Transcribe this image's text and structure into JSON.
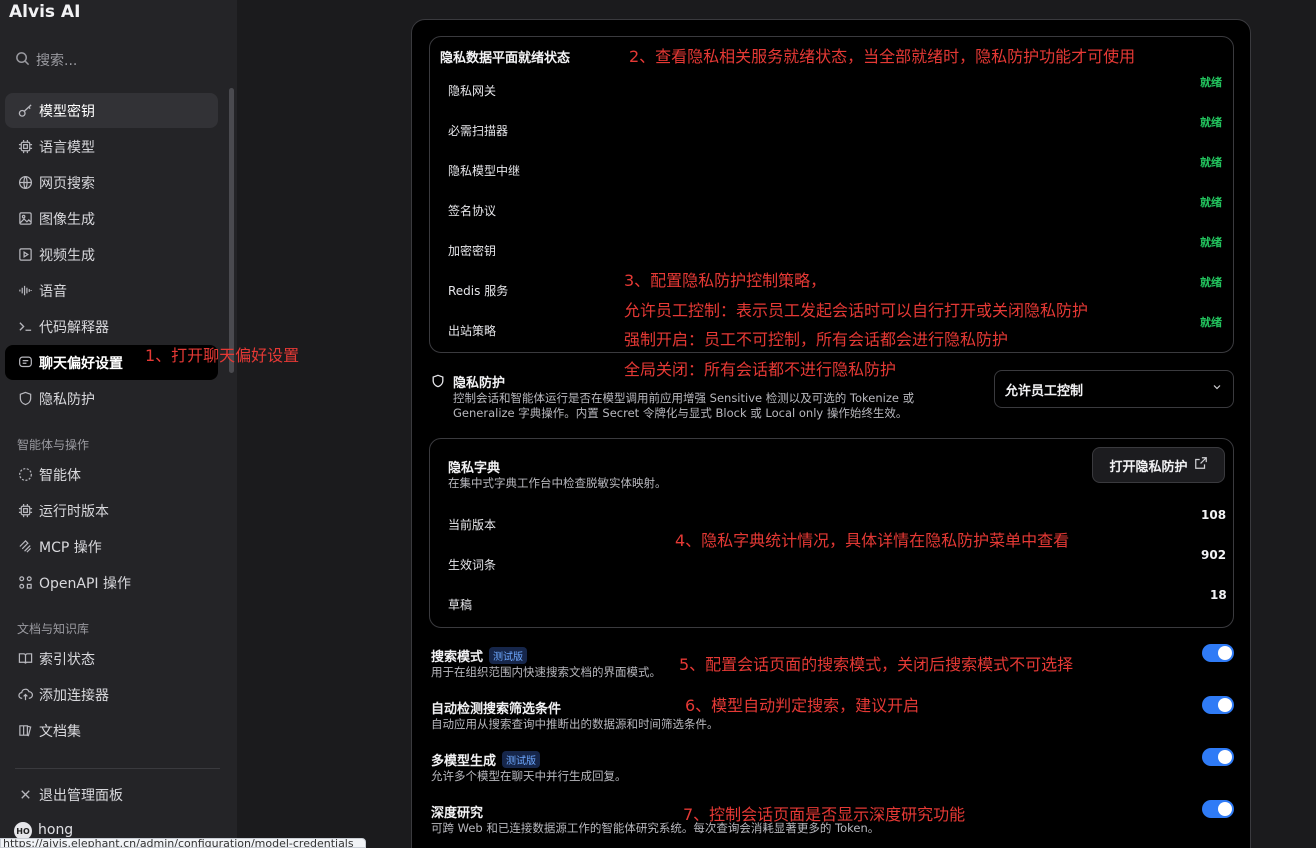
{
  "sidebar": {
    "app_title": "Alvis AI",
    "search_placeholder": "搜索...",
    "items": [
      {
        "label": "模型密钥",
        "icon": "key-icon"
      },
      {
        "label": "语言模型",
        "icon": "cpu-icon"
      },
      {
        "label": "网页搜索",
        "icon": "globe-icon"
      },
      {
        "label": "图像生成",
        "icon": "image-icon"
      },
      {
        "label": "视频生成",
        "icon": "video-icon"
      },
      {
        "label": "语音",
        "icon": "audio-wave-icon"
      },
      {
        "label": "代码解释器",
        "icon": "terminal-icon"
      },
      {
        "label": "聊天偏好设置",
        "icon": "chat-icon"
      },
      {
        "label": "隐私防护",
        "icon": "shield-icon"
      }
    ],
    "section_agents": "智能体与操作",
    "agent_items": [
      {
        "label": "智能体",
        "icon": "agent-icon"
      },
      {
        "label": "运行时版本",
        "icon": "cpu-icon"
      },
      {
        "label": "MCP 操作",
        "icon": "mcp-icon"
      },
      {
        "label": "OpenAPI 操作",
        "icon": "openapi-icon"
      }
    ],
    "section_docs": "文档与知识库",
    "doc_items": [
      {
        "label": "索引状态",
        "icon": "book-icon"
      },
      {
        "label": "添加连接器",
        "icon": "upload-cloud-icon"
      },
      {
        "label": "文档集",
        "icon": "files-icon"
      }
    ],
    "exit_label": "退出管理面板",
    "user_initials": "HO",
    "username": "hong",
    "status_url": "https://aivis.elephant.cn/admin/configuration/model-credentials"
  },
  "privacy_status": {
    "title": "隐私数据平面就绪状态",
    "rows": [
      {
        "label": "隐私网关",
        "status": "就绪"
      },
      {
        "label": "必需扫描器",
        "status": "就绪"
      },
      {
        "label": "隐私模型中继",
        "status": "就绪"
      },
      {
        "label": "签名协议",
        "status": "就绪"
      },
      {
        "label": "加密密钥",
        "status": "就绪"
      },
      {
        "label": "Redis 服务",
        "status": "就绪"
      },
      {
        "label": "出站策略",
        "status": "就绪"
      }
    ]
  },
  "privacy_protection": {
    "title": "隐私防护",
    "desc_line1": "控制会话和智能体运行是否在模型调用前应用增强 Sensitive 检测以及可选的 Tokenize 或",
    "desc_line2": "Generalize 字典操作。内置 Secret 令牌化与显式 Block 或 Local only 操作始终生效。",
    "selected_option": "允许员工控制"
  },
  "privacy_dictionary": {
    "title": "隐私字典",
    "desc": "在集中式字典工作台中检查脱敏实体映射。",
    "open_button": "打开隐私防护",
    "stats": [
      {
        "label": "当前版本",
        "value": "108"
      },
      {
        "label": "生效词条",
        "value": "902"
      },
      {
        "label": "草稿",
        "value": "18"
      }
    ]
  },
  "settings": [
    {
      "title": "搜索模式",
      "beta": "测试版",
      "desc": "用于在组织范围内快速搜索文档的界面模式。",
      "enabled": true
    },
    {
      "title": "自动检测搜索筛选条件",
      "beta": "",
      "desc": "自动应用从搜索查询中推断出的数据源和时间筛选条件。",
      "enabled": true
    },
    {
      "title": "多模型生成",
      "beta": "测试版",
      "desc": "允许多个模型在聊天中并行生成回复。",
      "enabled": true
    },
    {
      "title": "深度研究",
      "beta": "",
      "desc": "可跨 Web 和已连接数据源工作的智能体研究系统。每次查询会消耗显著更多的 Token。",
      "enabled": true
    }
  ],
  "annotations": {
    "a1": "1、打开聊天偏好设置",
    "a2": "2、查看隐私相关服务就绪状态，当全部就绪时，隐私防护功能才可使用",
    "a3_1": "3、配置隐私防护控制策略，",
    "a3_2": "允许员工控制：表示员工发起会话时可以自行打开或关闭隐私防护",
    "a3_3": "强制开启：员工不可控制，所有会话都会进行隐私防护",
    "a3_4": "全局关闭：所有会话都不进行隐私防护",
    "a4": "4、隐私字典统计情况，具体详情在隐私防护菜单中查看",
    "a5": "5、配置会话页面的搜索模式，关闭后搜索模式不可选择",
    "a6": "6、模型自动判定搜索，建议开启",
    "a7": "7、控制会话页面是否显示深度研究功能"
  },
  "colors": {
    "accent": "#2f7bf6",
    "ready": "#22c55e",
    "annotation": "#e53935"
  }
}
